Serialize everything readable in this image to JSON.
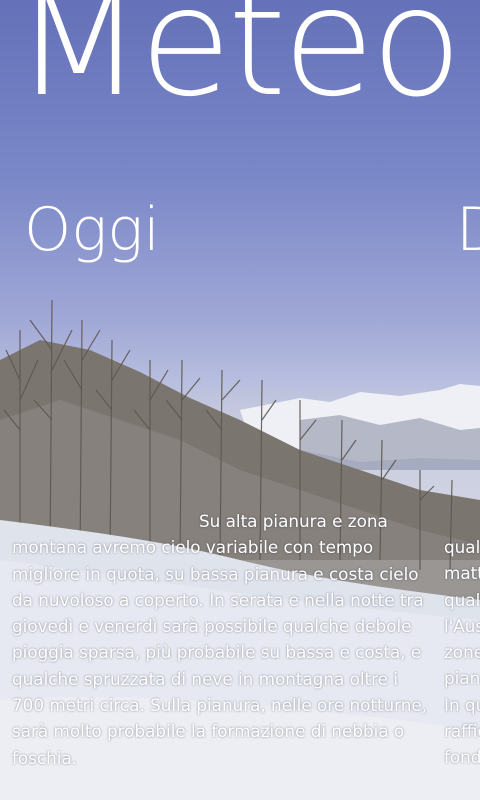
{
  "app": {
    "title": "Meteo"
  },
  "sections": [
    {
      "title": "Oggi",
      "text": "Su alta pianura e zona montana avremo cielo variabile con tempo migliore in quota, su bassa pianura e costa cielo da nuvoloso a coperto. In serata e nella notte tra giovedì e venerdì sarà possibile qualche debole pioggia sparsa, più probabile su bassa e costa, e qualche spruzzata di neve in montagna oltre i 700 metri circa. Sulla pianura, nelle ore notturne, sarà molto probabile la formazione di nebbia o foschia."
    },
    {
      "title": "D",
      "lines": [
        "qual",
        "matt",
        "qual",
        "l'Aus",
        "zone",
        "pian",
        "In qu",
        "raffic",
        "fond"
      ]
    }
  ],
  "colors": {
    "text": "#ffffff",
    "sky": "#6f7fbf",
    "snow": "#e2e6ef"
  }
}
